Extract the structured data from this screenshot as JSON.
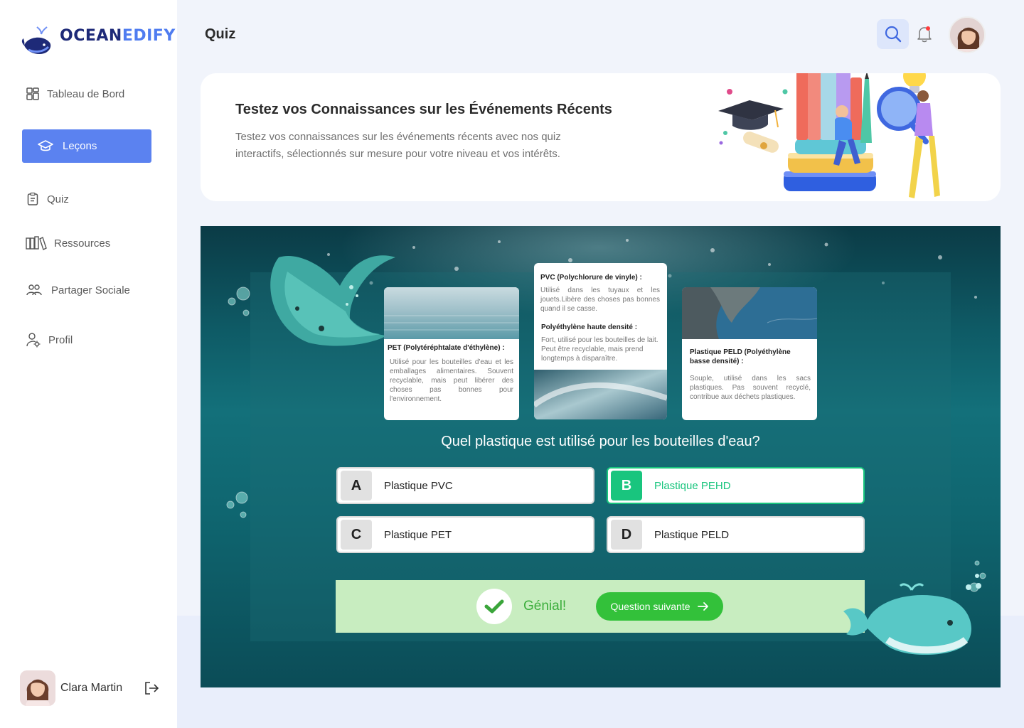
{
  "brand": {
    "logo_part1": "OCEAN",
    "logo_part2": "EDIFY"
  },
  "sidebar": {
    "items": [
      {
        "label": "Tableau de Bord",
        "icon": "grid-icon"
      },
      {
        "label": "Leçons",
        "icon": "graduation-cap-icon",
        "active": true
      },
      {
        "label": "Quiz",
        "icon": "clipboard-icon"
      },
      {
        "label": "Ressources",
        "icon": "books-icon"
      },
      {
        "label": "Partager Sociale",
        "icon": "people-icon"
      },
      {
        "label": "Profil",
        "icon": "user-gear-icon"
      }
    ],
    "user": {
      "name": "Clara Martin"
    }
  },
  "header": {
    "title": "Quiz"
  },
  "hero": {
    "title": "Testez vos Connaissances sur les Événements Récents",
    "description": "Testez vos connaissances sur les événements récents avec nos quiz interactifs, sélectionnés sur mesure pour votre niveau et vos intérêts."
  },
  "cards": {
    "pet": {
      "title": "PET (Polytéréphtalate d'éthylène) :",
      "body": "Utilisé pour les bouteilles d'eau et les emballages alimentaires. Souvent recyclable, mais peut libérer des choses pas bonnes pour l'environnement."
    },
    "pvc": {
      "title": "PVC (Polychlorure de vinyle) :",
      "body": "Utilisé dans les tuyaux et les jouets.Libère des choses pas bonnes quand il se casse."
    },
    "pehd": {
      "title": "Polyéthylène haute  densité :",
      "body": "Fort, utilisé pour les bouteilles de lait. Peut être recyclable, mais prend longtemps à disparaître."
    },
    "peld": {
      "title": "Plastique PELD (Polyéthylène basse densité) :",
      "body": "Souple, utilisé dans les sacs plastiques. Pas souvent recyclé, contribue aux déchets plastiques."
    }
  },
  "quiz": {
    "question": "Quel plastique est utilisé pour les bouteilles d'eau?",
    "options": [
      {
        "letter": "A",
        "label": "Plastique PVC"
      },
      {
        "letter": "B",
        "label": "Plastique PEHD",
        "selected_correct": true
      },
      {
        "letter": "C",
        "label": "Plastique PET"
      },
      {
        "letter": "D",
        "label": "Plastique PELD"
      }
    ],
    "feedback": "Génial!",
    "next_label": "Question suivante"
  },
  "colors": {
    "accent": "#5b82f0",
    "correct": "#19c57e",
    "success_bg": "#c8edc0",
    "success_btn": "#33c13a"
  }
}
